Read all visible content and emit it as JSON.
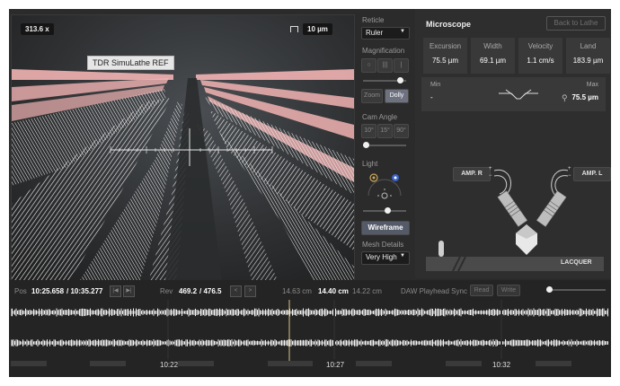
{
  "viewport": {
    "scale_label": "313.6 x",
    "unit_label": "10 µm",
    "tooltip": "TDR SimuLathe REF"
  },
  "sidebar": {
    "reticle_label": "Reticle",
    "reticle_value": "Ruler",
    "magnification_label": "Magnification",
    "zoom_label": "Zoom",
    "dolly_label": "Dolly",
    "cam_angle_label": "Cam Angle",
    "cam_angles": [
      "10°",
      "15°",
      "90°"
    ],
    "light_label": "Light",
    "wireframe_label": "Wireframe",
    "mesh_details_label": "Mesh Details",
    "mesh_details_value": "Very High"
  },
  "microscope": {
    "title": "Microscope",
    "back_label": "Back to Lathe",
    "stats": [
      {
        "label": "Excursion",
        "value": "75.5 µm"
      },
      {
        "label": "Width",
        "value": "69.1 µm"
      },
      {
        "label": "Velocity",
        "value": "1.1 cm/s"
      },
      {
        "label": "Land",
        "value": "183.9 µm"
      }
    ],
    "min_label": "Min",
    "min_value": "-",
    "max_label": "Max",
    "max_value": "75.5 µm",
    "amp_r_label": "AMP. R",
    "amp_l_label": "AMP. L",
    "lacquer_label": "LACQUER"
  },
  "timeline": {
    "pos_label": "Pos",
    "pos_value": "10:25.658",
    "pos_total": "/ 10:35.277",
    "rev_label": "Rev",
    "rev_value": "469.2",
    "rev_total": "/ 476.5",
    "radius_left": "14.63 cm",
    "radius_current": "14.40 cm",
    "radius_right": "14.22 cm",
    "daw_label": "DAW Playhead Sync",
    "read_label": "Read",
    "write_label": "Write",
    "time_marks": [
      "10:22",
      "10:27",
      "10:32"
    ]
  },
  "colors": {
    "groove_pink": "#f2b3b3",
    "wire_white": "#f4f4f4",
    "accent_blue": "#3a62c8",
    "playhead": "#d8c28a"
  }
}
